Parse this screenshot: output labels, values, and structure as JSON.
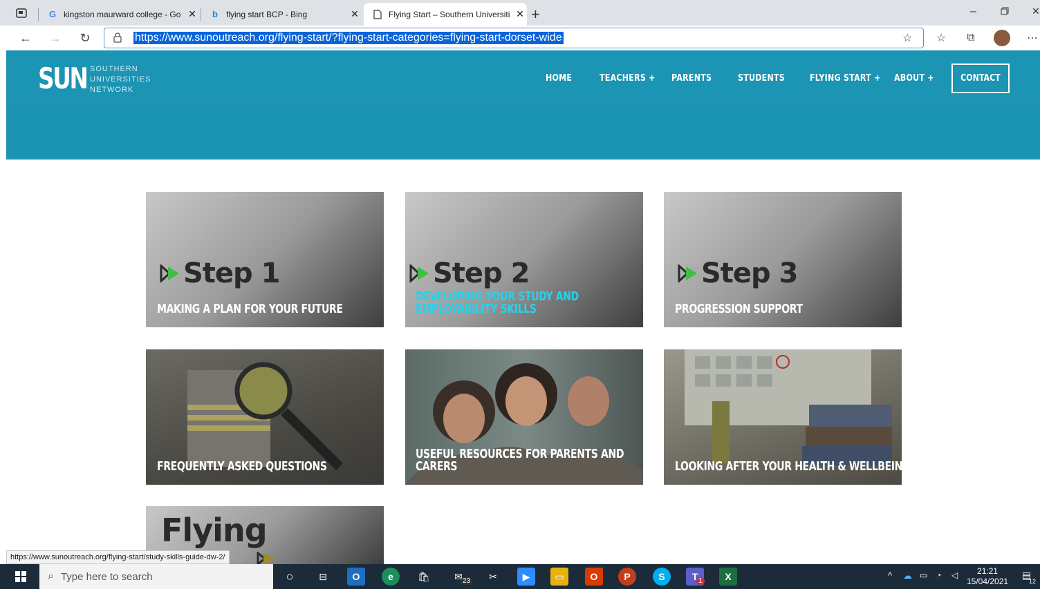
{
  "browser": {
    "tabs": [
      {
        "title": "kingston maurward college - Go",
        "favicon": "google-icon"
      },
      {
        "title": "flying start BCP - Bing",
        "favicon": "bing-icon"
      },
      {
        "title": "Flying Start – Southern Universiti",
        "favicon": "page-icon"
      }
    ],
    "url": "https://www.sunoutreach.org/flying-start/?flying-start-categories=flying-start-dorset-wide",
    "status_link": "https://www.sunoutreach.org/flying-start/study-skills-guide-dw-2/"
  },
  "site": {
    "logo": {
      "mark": "SUN",
      "line1": "SOUTHERN",
      "line2": "UNIVERSITIES",
      "line3": "NETWORK"
    },
    "nav": {
      "home": "HOME",
      "teachers": "TEACHERS  +",
      "parents": "PARENTS",
      "students": "STUDENTS",
      "flying_start": "FLYING START  +",
      "about": "ABOUT  +",
      "contact": "CONTACT"
    },
    "cards": [
      {
        "step": "Step 1",
        "label_lines": [
          "MAKING A PLAN FOR YOUR FUTURE"
        ]
      },
      {
        "step": "Step 2",
        "label_lines": [
          "DEVELOPING YOUR STUDY AND",
          "EMPLOYABILITY SKILLS"
        ]
      },
      {
        "step": "Step 3",
        "label_lines": [
          "PROGRESSION SUPPORT"
        ]
      },
      {
        "label_lines": [
          "FREQUENTLY ASKED QUESTIONS"
        ]
      },
      {
        "label_lines": [
          "USEFUL RESOURCES FOR PARENTS AND",
          "CARERS"
        ]
      },
      {
        "label_lines": [
          "LOOKING AFTER YOUR HEALTH & WELLBEING"
        ]
      },
      {
        "title": "Flying"
      }
    ]
  },
  "taskbar": {
    "search_placeholder": "Type here to search",
    "mail_badge": "23",
    "teams_badge": "1",
    "time": "21:21",
    "date": "15/04/2021",
    "notification_count": "12"
  },
  "colors": {
    "header": "#1c94b3",
    "cyan_label": "#22d3ee",
    "step_green": "#3fbf3f"
  }
}
